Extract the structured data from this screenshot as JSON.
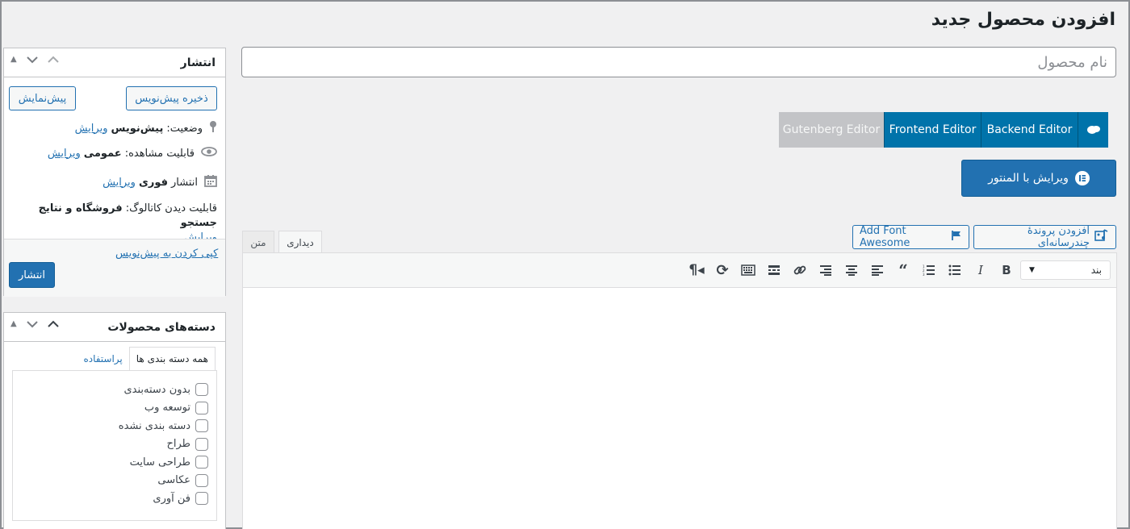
{
  "header": {
    "title": "افزودن محصول جدید"
  },
  "product": {
    "name_placeholder": "نام محصول"
  },
  "editor_switch": {
    "gutenberg": "Gutenberg Editor",
    "frontend": "Frontend Editor",
    "backend": "Backend Editor",
    "wpbakery_icon": "wpbakery-icon"
  },
  "elementor": {
    "label": "ویرایش با المنتور",
    "icon": "elementor-icon"
  },
  "media": {
    "add_media": "افزودن پروندهٔ چندرسانه‌ای",
    "font_awesome": "Add Font Awesome"
  },
  "editor_tabs": {
    "visual": "دیداری",
    "text": "متن"
  },
  "toolbar": {
    "format_value": "بند",
    "tools": [
      "bold-icon",
      "italic-icon",
      "bullet-list-icon",
      "numbered-list-icon",
      "blockquote-icon",
      "align-left-icon",
      "align-center-icon",
      "align-right-icon",
      "link-icon",
      "read-more-icon",
      "toolbar-toggle-icon",
      "refresh-icon",
      "paragraph-rtl-icon"
    ]
  },
  "publish": {
    "title": "انتشار",
    "save_draft": "ذخیره پیش‌نویس",
    "preview": "پیش‌نمایش",
    "status_label": "وضعیت:",
    "status_value": "پیش‌نویس",
    "visibility_label": "قابلیت مشاهده:",
    "visibility_value": "عمومی",
    "publish_label": "انتشار",
    "publish_value": "فوری",
    "edit_link": "ویرایش",
    "catalog_label": "قابلیت دیدن کاتالوگ:",
    "catalog_value": "فروشگاه و نتایج جستجو",
    "copy_draft": "کپی کردن به پیش‌نویس",
    "publish_button": "انتشار"
  },
  "categories": {
    "title": "دسته‌های محصولات",
    "tab_all": "همه دسته بندی ها",
    "tab_popular": "پراستفاده",
    "items": [
      "بدون دسته‌بندی",
      "توسعه وب",
      "دسته بندی نشده",
      "طراح",
      "طراحی سایت",
      "عکاسی",
      "فن آوری"
    ]
  }
}
